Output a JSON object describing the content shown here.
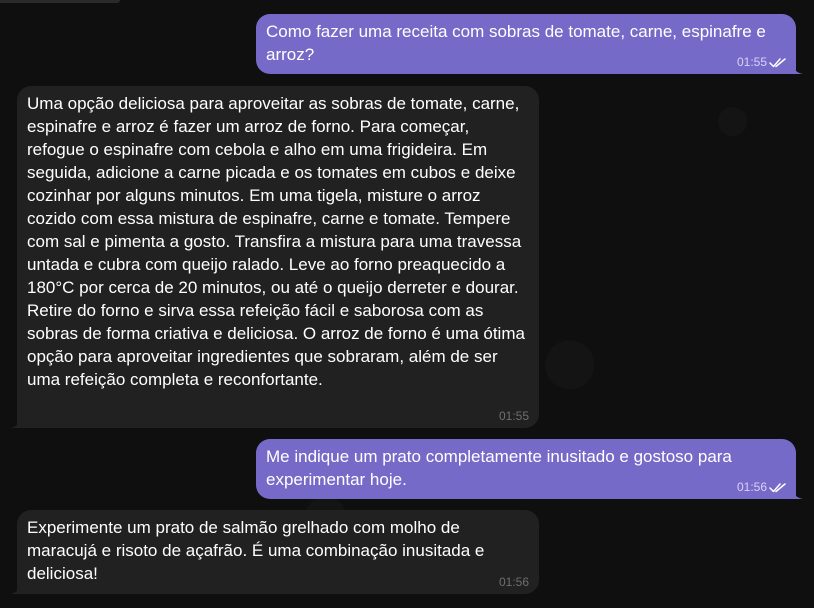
{
  "messages": [
    {
      "direction": "outgoing",
      "text": "Como fazer uma receita com sobras de tomate, carne, espinafre e arroz?",
      "time": "01:55",
      "status_icon": "double-check-icon"
    },
    {
      "direction": "incoming",
      "text": "Uma opção deliciosa para aproveitar as sobras de tomate, carne, espinafre e arroz é fazer um arroz de forno. Para começar, refogue o espinafre com cebola e alho em uma frigideira. Em seguida, adicione a carne picada e os tomates em cubos e deixe cozinhar por alguns minutos. Em uma tigela, misture o arroz cozido com essa mistura de espinafre, carne e tomate. Tempere com sal e pimenta a gosto. Transfira a mistura para uma travessa untada e cubra com queijo ralado. Leve ao forno preaquecido a 180°C por cerca de 20 minutos, ou até o queijo derreter e dourar. Retire do forno e sirva essa refeição fácil e saborosa com as sobras de forma criativa e deliciosa. O arroz de forno é uma ótima opção para aproveitar ingredientes que sobraram, além de ser uma refeição completa e reconfortante.",
      "time": "01:55"
    },
    {
      "direction": "outgoing",
      "text": "Me indique um prato completamente inusitado e gostoso para experimentar hoje.",
      "time": "01:56",
      "status_icon": "double-check-icon"
    },
    {
      "direction": "incoming",
      "text": "Experimente um prato de salmão grelhado com molho de maracujá e risoto de açafrão. É uma combinação inusitada e deliciosa!",
      "time": "01:56"
    }
  ],
  "colors": {
    "outgoing_bubble": "#766ac8",
    "incoming_bubble": "#212121",
    "background": "#0f0f0f"
  }
}
